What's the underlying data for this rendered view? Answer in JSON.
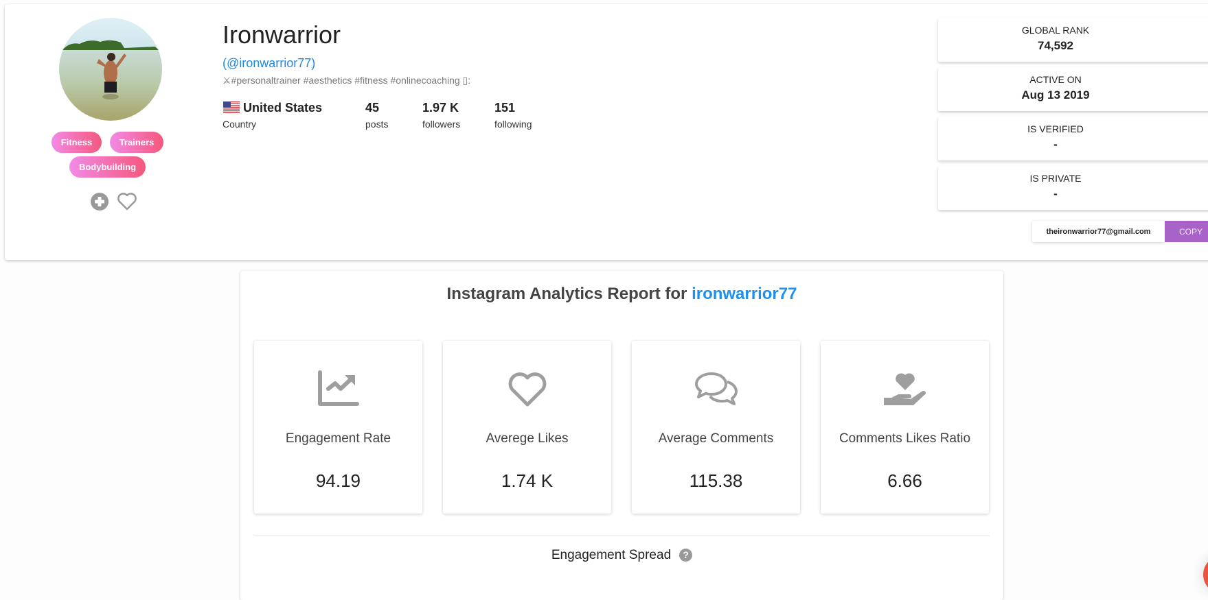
{
  "profile": {
    "display_name": "Ironwarrior",
    "handle": "(@ironwarrior77)",
    "bio": "⚔#personaltrainer #aesthetics #fitness #onlinecoaching ▯:",
    "categories": [
      "Fitness",
      "Trainers",
      "Bodybuilding"
    ],
    "actions": {
      "add_icon": "plus-circle-icon",
      "favorite_icon": "heart-outline-icon"
    },
    "country": {
      "flag_icon": "us-flag-icon",
      "name": "United States",
      "label": "Country"
    },
    "stats": [
      {
        "value": "45",
        "label": "posts"
      },
      {
        "value": "1.97 K",
        "label": "followers"
      },
      {
        "value": "151",
        "label": "following"
      }
    ]
  },
  "info_cards": [
    {
      "label": "GLOBAL RANK",
      "value": "74,592"
    },
    {
      "label": "ACTIVE ON",
      "value": "Aug 13 2019"
    },
    {
      "label": "IS VERIFIED",
      "value": "-"
    },
    {
      "label": "IS PRIVATE",
      "value": "-"
    }
  ],
  "contact": {
    "email": "theironwarrior77@gmail.com",
    "copy_label": "COPY"
  },
  "report": {
    "title_prefix": "Instagram Analytics Report for ",
    "title_user": "ironwarrior77",
    "metrics": [
      {
        "icon": "chart-line-icon",
        "label": "Engagement Rate",
        "value": "94.19"
      },
      {
        "icon": "heart-outline-icon",
        "label": "Averege Likes",
        "value": "1.74 K"
      },
      {
        "icon": "comments-icon",
        "label": "Average Comments",
        "value": "115.38"
      },
      {
        "icon": "hand-holding-heart-icon",
        "label": "Comments Likes Ratio",
        "value": "6.66"
      }
    ],
    "section_title": "Engagement Spread",
    "help_glyph": "?"
  },
  "colors": {
    "accent": "#1e88e5",
    "copy_button": "#a862c8",
    "tag_start": "#f28ae6",
    "tag_end": "#f4587c",
    "icon_grey": "#9e9e9e"
  }
}
